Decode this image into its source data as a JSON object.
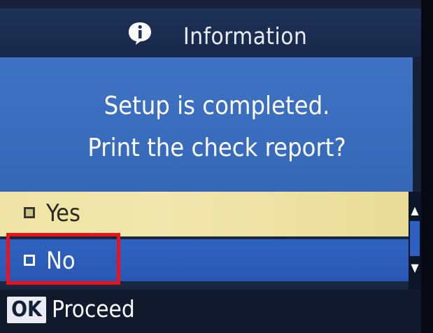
{
  "header": {
    "icon": "info-icon",
    "title": "Information"
  },
  "message": {
    "line1": "Setup is completed.",
    "line2": "Print the check report?"
  },
  "options": [
    {
      "label": "Yes",
      "state": "hovered"
    },
    {
      "label": "No",
      "state": "selected"
    }
  ],
  "footer": {
    "ok_badge": "OK",
    "proceed": "Proceed"
  },
  "colors": {
    "title_bar": "#1e3357",
    "message_panel": "#3f73c4",
    "option_yes_bg": "#efe4a5",
    "option_no_bg": "#2f62c0",
    "highlight_border": "#e8141c"
  }
}
